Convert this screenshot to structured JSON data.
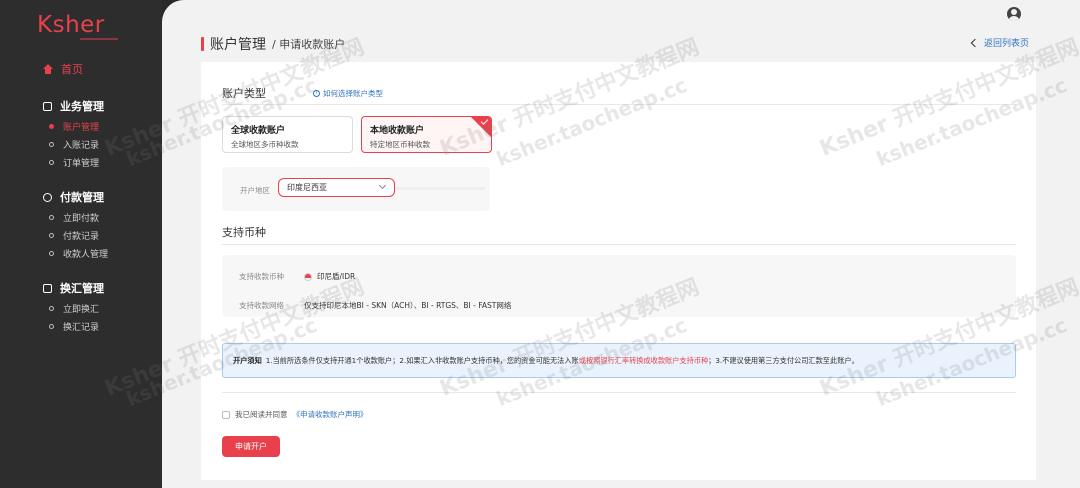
{
  "brand": {
    "logo": "Ksher"
  },
  "sidebar": {
    "home": "首页",
    "groups": [
      {
        "title": "业务管理",
        "items": [
          "账户管理",
          "入账记录",
          "订单管理"
        ]
      },
      {
        "title": "付款管理",
        "items": [
          "立即付款",
          "付款记录",
          "收款人管理"
        ]
      },
      {
        "title": "换汇管理",
        "items": [
          "立即换汇",
          "换汇记录"
        ]
      }
    ]
  },
  "header": {
    "title": "账户管理",
    "subtitle": "/ 申请收款账户",
    "back": "返回列表页"
  },
  "account_type": {
    "heading": "账户类型",
    "help": "如何选择账户类型",
    "options": [
      {
        "title": "全球收款账户",
        "desc": "全球地区多币种收款"
      },
      {
        "title": "本地收款账户",
        "desc": "特定地区币种收款"
      }
    ],
    "region_label": "开户地区",
    "region_value": "印度尼西亚"
  },
  "currency": {
    "heading": "支持币种",
    "currency_label": "支持收款币种",
    "currency_value": "印尼盾/IDR",
    "network_label": "支持收款网络",
    "network_value": "仅支持印尼本地BI - SKN（ACH）、BI - RTGS、BI - FAST网络"
  },
  "notice": {
    "bold": "开户须知",
    "part1": "1.当前所选条件仅支持开通1个收款账户；2.如果汇入非收款账户支持币种，您的资金可能无法入账",
    "red": "或按照银行汇率转换成收款账户支持币种",
    "part2": "；3.不建议使用第三方支付公司汇款至此账户。"
  },
  "agreement": {
    "text": "我已阅读并同意",
    "link": "《申请收款账户声明》"
  },
  "submit": "申请开户",
  "watermark": {
    "a": "Ksher 开时支付中文教程网",
    "b": "ksher.taocheap.cc"
  }
}
